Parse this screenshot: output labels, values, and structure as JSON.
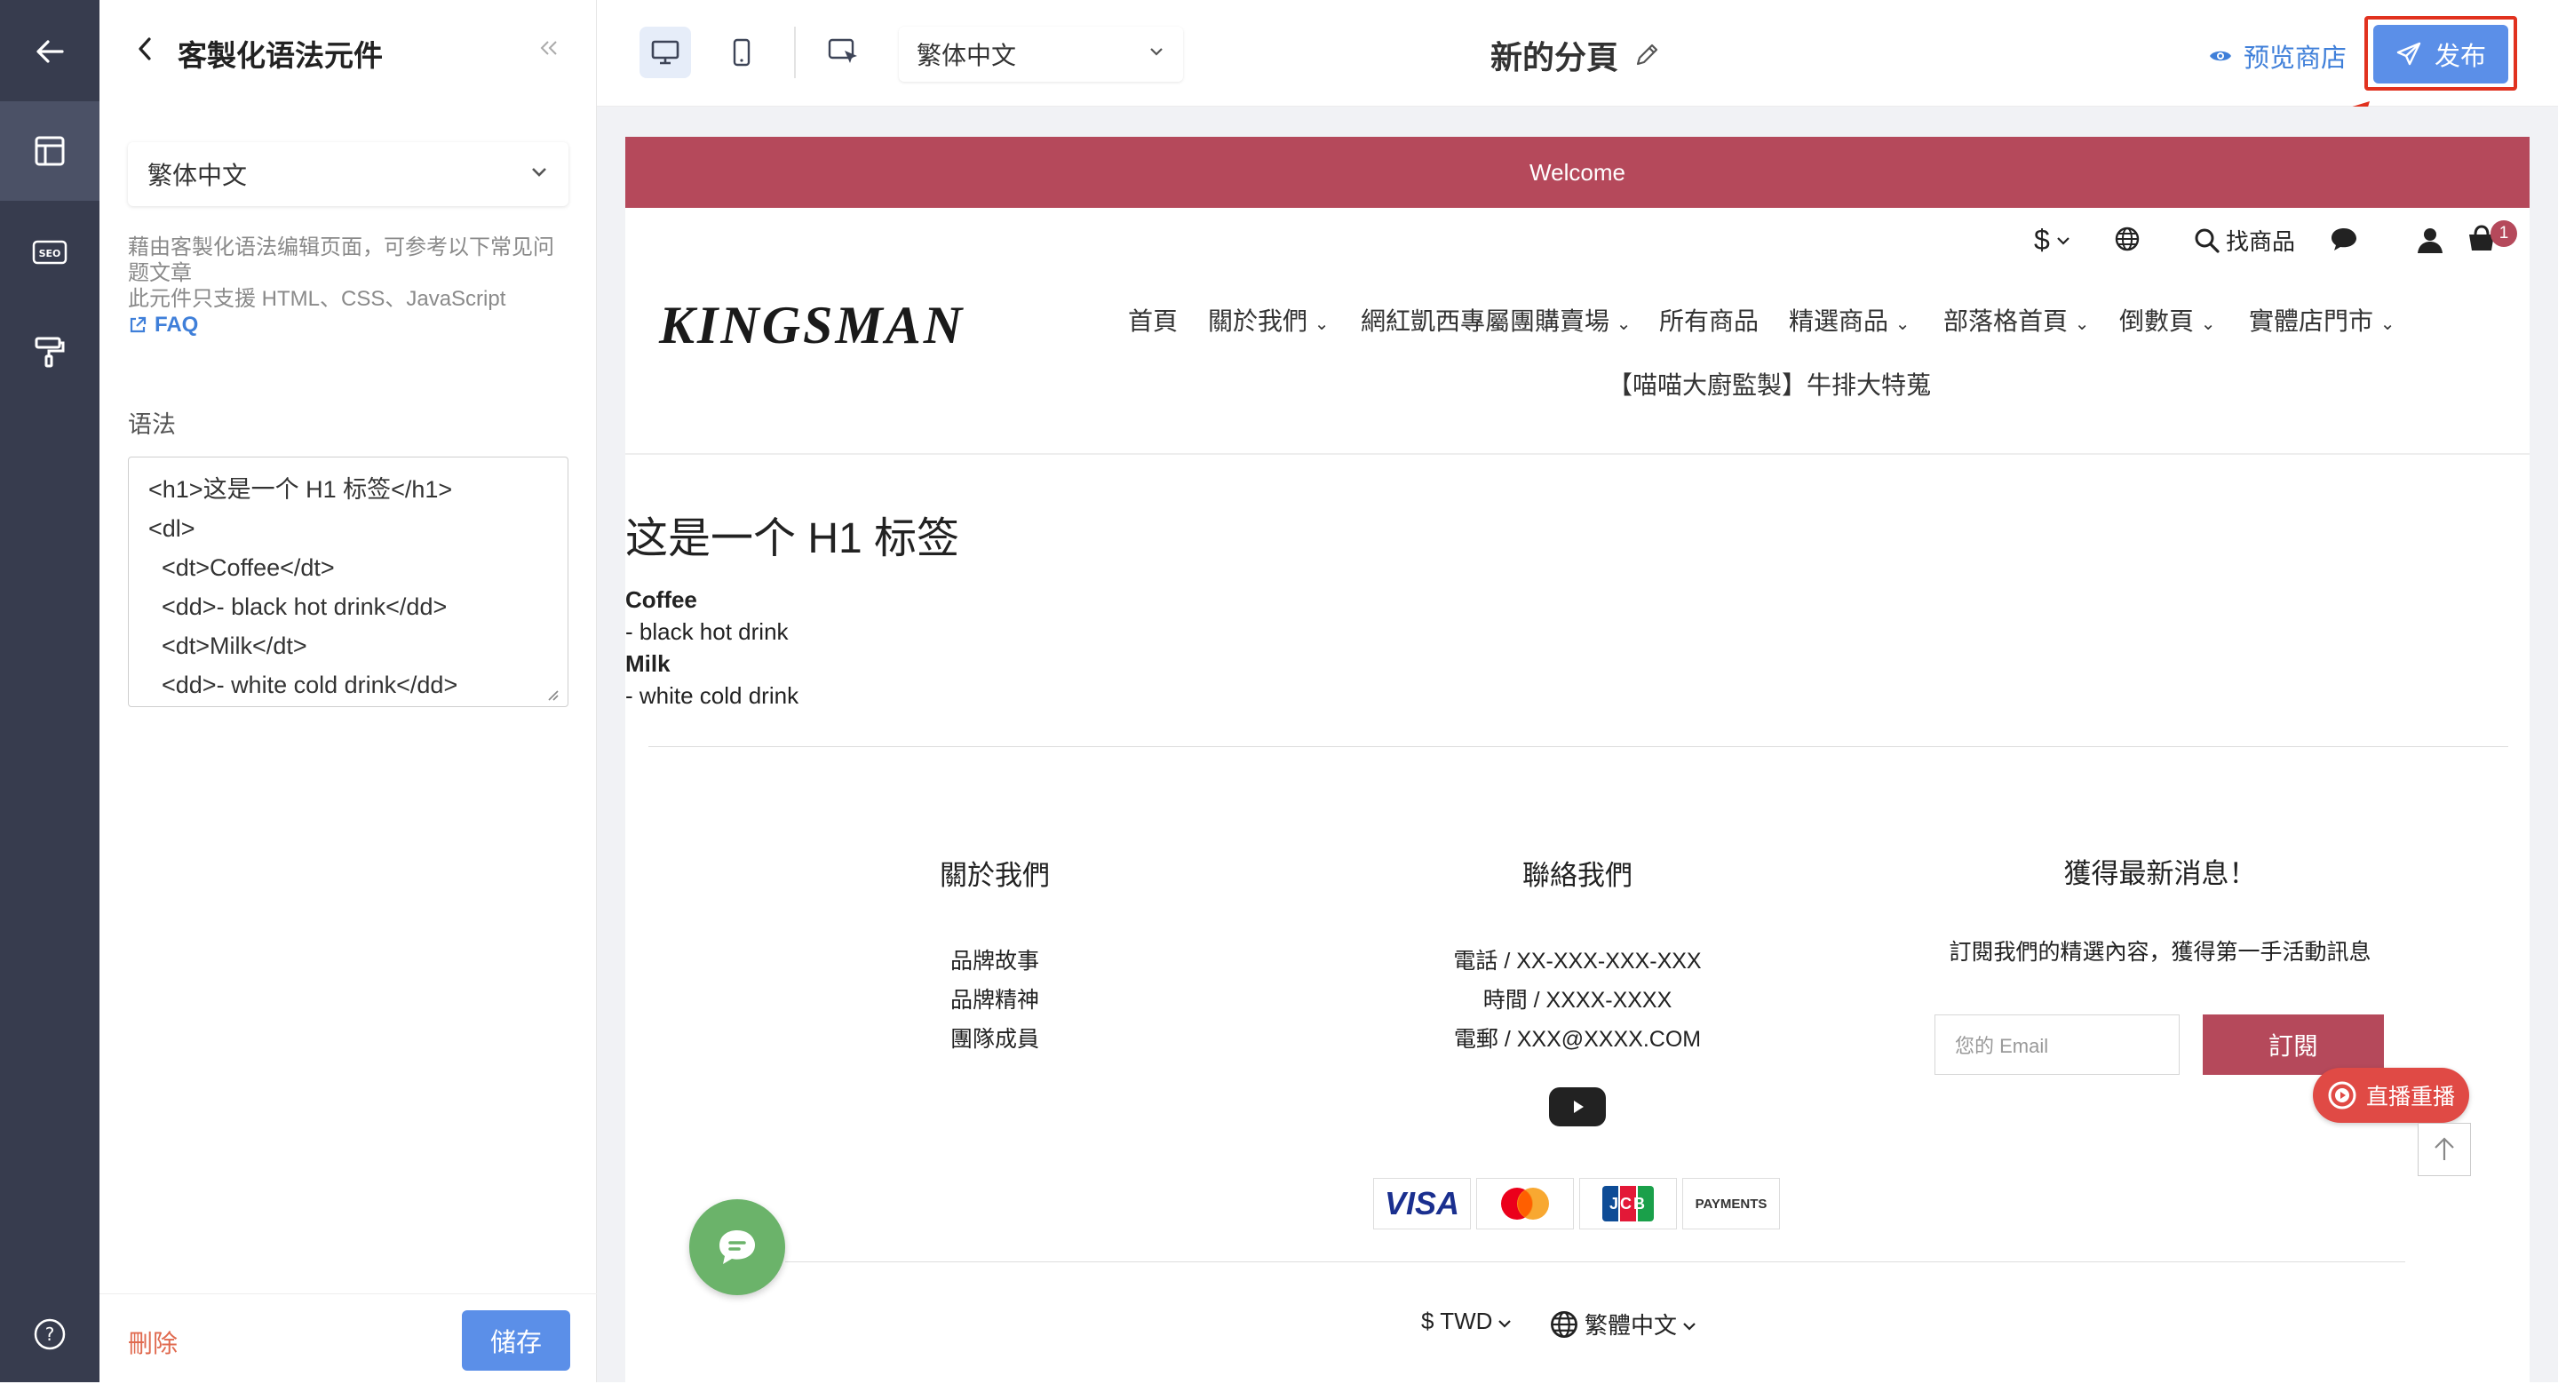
{
  "editor": {
    "title": "客製化语法元件",
    "language_selected": "繁体中文",
    "help_text": "藉由客製化语法编辑页面，可参考以下常见问题文章",
    "support_text": "此元件只支援 HTML、CSS、JavaScript",
    "faq_label": "FAQ",
    "syntax_label": "语法",
    "code": "<h1>这是一个 H1 标签</h1>\n<dl>\n  <dt>Coffee</dt>\n  <dd>- black hot drink</dd>\n  <dt>Milk</dt>\n  <dd>- white cold drink</dd>",
    "delete_label": "刪除",
    "save_label": "储存"
  },
  "toolbar": {
    "language_selected": "繁体中文",
    "page_title": "新的分頁",
    "preview_label": "预览商店",
    "publish_label": "发布"
  },
  "store": {
    "welcome": "Welcome",
    "currency_symbol": "$",
    "search_label": "找商品",
    "cart_count": "1",
    "logo": "KINGSMAN",
    "nav": [
      "首頁",
      "關於我們",
      "網紅凱西專屬團購賣場",
      "所有商品",
      "精選商品",
      "部落格首頁",
      "倒數頁",
      "實體店門市"
    ],
    "nav_row2": "【喵喵大廚監製】牛排大特蒐",
    "content": {
      "h1": "这是一个 H1 标签",
      "items": [
        {
          "term": "Coffee",
          "desc": "- black hot drink"
        },
        {
          "term": "Milk",
          "desc": "- white cold drink"
        }
      ]
    },
    "footer": {
      "about": {
        "title": "關於我們",
        "links": [
          "品牌故事",
          "品牌精神",
          "團隊成員"
        ]
      },
      "contact": {
        "title": "聯絡我們",
        "lines": [
          "電話 / XX-XXX-XXX-XXX",
          "時間 / XXXX-XXXX",
          "電郵 / XXX@XXXX.COM"
        ]
      },
      "news": {
        "title": "獲得最新消息！",
        "desc": "訂閱我們的精選內容，獲得第一手活動訊息",
        "email_placeholder": "您的 Email",
        "subscribe_label": "訂閱"
      },
      "live_label": "直播重播",
      "payments": [
        "VISA",
        "JCB",
        "PAYMENTS"
      ],
      "currency": "$ TWD",
      "language": "繁體中文"
    }
  },
  "colors": {
    "brand": "#b5495b",
    "accent": "#5b8fe8",
    "rail": "#373c4e",
    "highlight": "#e1321f"
  }
}
